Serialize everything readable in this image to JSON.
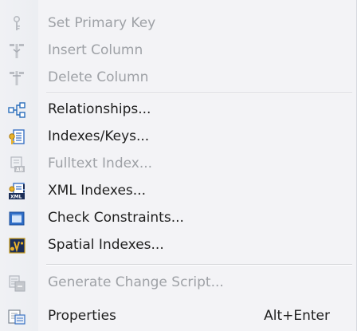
{
  "menu": {
    "items": [
      {
        "label": "Set Primary Key",
        "icon": "key-icon",
        "enabled": false
      },
      {
        "label": "Insert Column",
        "icon": "insert-column-icon",
        "enabled": false
      },
      {
        "label": "Delete Column",
        "icon": "delete-column-icon",
        "enabled": false
      },
      {
        "label": "Relationships...",
        "icon": "relationships-icon",
        "enabled": true
      },
      {
        "label": "Indexes/Keys...",
        "icon": "indexes-keys-icon",
        "enabled": true
      },
      {
        "label": "Fulltext Index...",
        "icon": "fulltext-index-icon",
        "enabled": false
      },
      {
        "label": "XML Indexes...",
        "icon": "xml-indexes-icon",
        "enabled": true
      },
      {
        "label": "Check Constraints...",
        "icon": "check-constraints-icon",
        "enabled": true
      },
      {
        "label": "Spatial Indexes...",
        "icon": "spatial-indexes-icon",
        "enabled": true
      },
      {
        "label": "Generate Change Script...",
        "icon": "generate-script-icon",
        "enabled": false
      },
      {
        "label": "Properties",
        "icon": "properties-icon",
        "enabled": true,
        "shortcut": "Alt+Enter"
      }
    ]
  }
}
